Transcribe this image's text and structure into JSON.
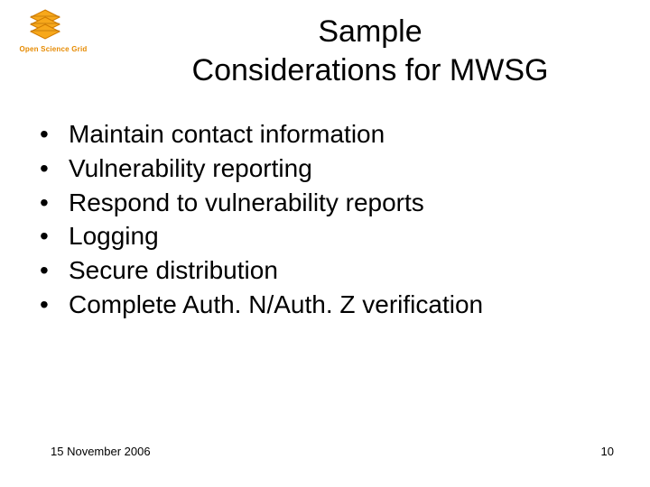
{
  "logo": {
    "label": "Open Science Grid"
  },
  "title": {
    "line1": "Sample",
    "line2": "Considerations for MWSG"
  },
  "bullets": [
    "Maintain contact information",
    "Vulnerability reporting",
    "Respond to vulnerability reports",
    "Logging",
    "Secure distribution",
    "Complete Auth. N/Auth. Z verification"
  ],
  "footer": {
    "date": "15 November 2006",
    "page": "10"
  }
}
